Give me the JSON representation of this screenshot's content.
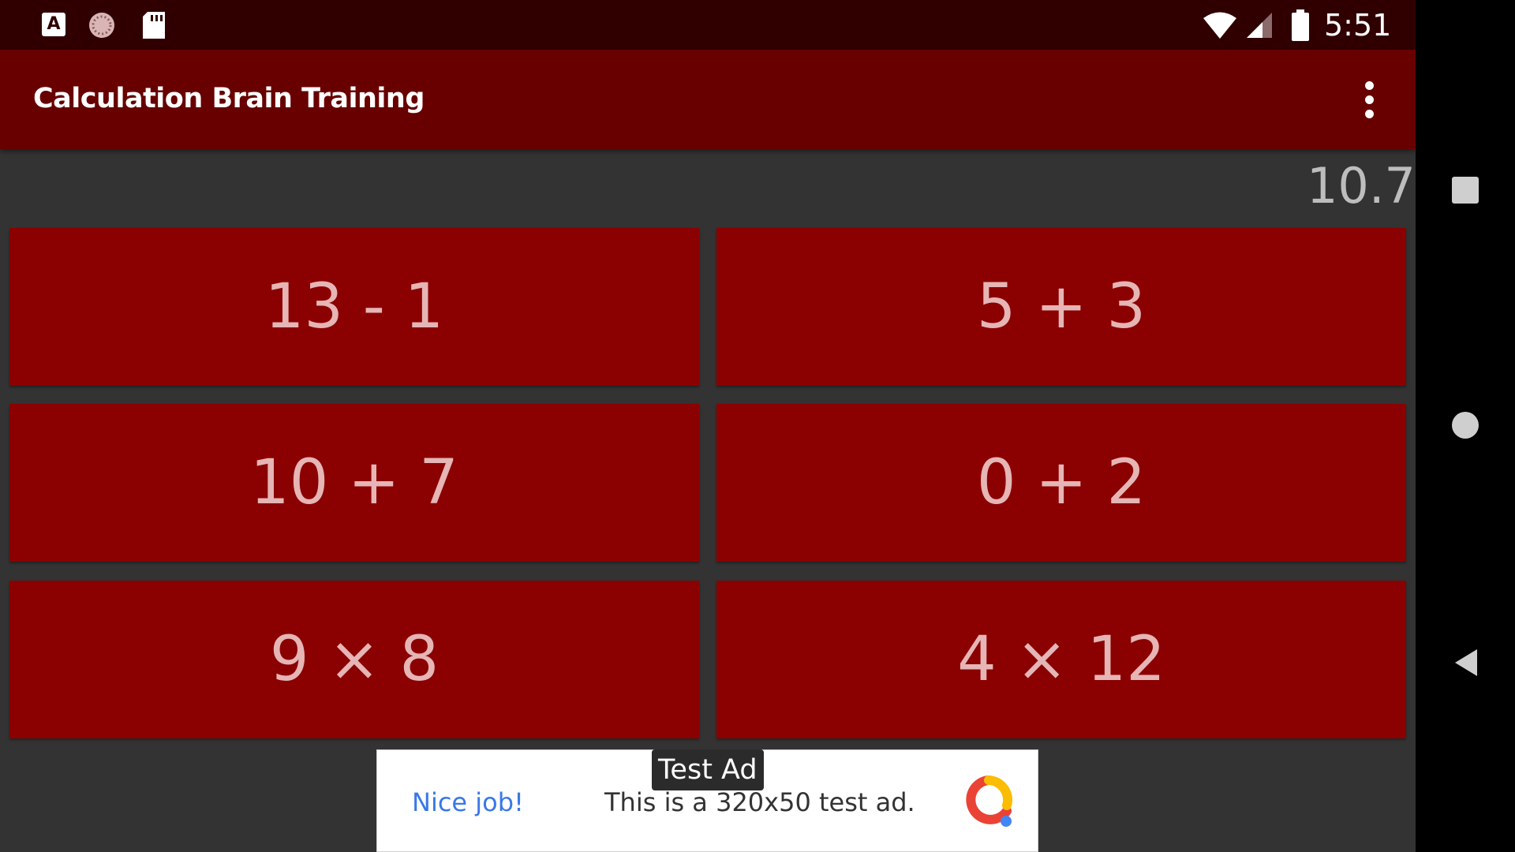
{
  "status_bar": {
    "time": "5:51",
    "icons": [
      "a-notification-icon",
      "loading-circle-icon",
      "sd-card-icon",
      "wifi-icon",
      "cell-signal-icon",
      "battery-icon"
    ]
  },
  "app_bar": {
    "title": "Calculation Brain Training",
    "menu_icon": "more-vert-icon"
  },
  "timer": "10.7",
  "problems": [
    "13 - 1",
    "5 + 3",
    "10 + 7",
    "0 + 2",
    "9 × 8",
    "4 × 12"
  ],
  "ad": {
    "label": "Test Ad",
    "headline": "Nice job!",
    "body": "This is a 320x50 test ad.",
    "logo_icon": "ads-logo-icon"
  },
  "nav_bar": {
    "icons": [
      "recents-icon",
      "home-icon",
      "back-icon"
    ]
  },
  "colors": {
    "status_bar": "#300000",
    "app_bar": "#680000",
    "background": "#333333",
    "button": "#8b0000",
    "button_text": "#e6b5b5",
    "timer_text": "#bdbdbd",
    "ad_headline": "#3a78e6"
  }
}
